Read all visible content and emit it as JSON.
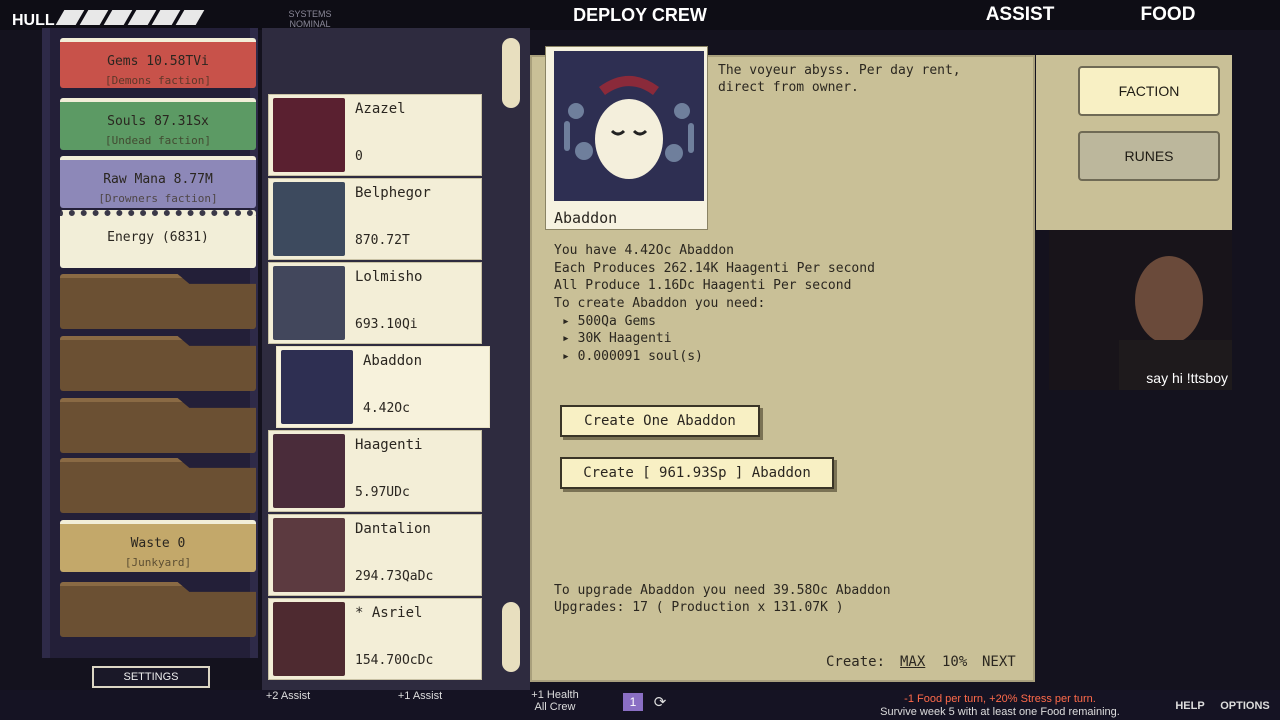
{
  "topbar": {
    "hull": "HULL",
    "systems": "SYSTEMS\nNOMINAL",
    "title": "DEPLOY CREW",
    "assist": "ASSIST",
    "food": "FOOD"
  },
  "factions": [
    {
      "label": "Gems 10.58TVi",
      "sub": "[Demons faction]",
      "color": "#c8524a"
    },
    {
      "label": "Souls 87.31Sx",
      "sub": "[Undead faction]",
      "color": "#5c9a64"
    },
    {
      "label": "Raw Mana 8.77M",
      "sub": "[Drowners faction]",
      "color": "#8d88b8"
    },
    {
      "label": "Energy (6831)",
      "sub": "",
      "color": "#f2eed8"
    },
    {
      "label": "Waste 0",
      "sub": "[Junkyard]",
      "color": "#c3a86a"
    }
  ],
  "settings_label": "SETTINGS",
  "monsters": [
    {
      "name": "Azazel",
      "value": "0",
      "bg": "#5a2030"
    },
    {
      "name": "Belphegor",
      "value": "870.72T",
      "bg": "#3d4a5e"
    },
    {
      "name": "Lolmisho",
      "value": "693.10Qi",
      "bg": "#42475c"
    },
    {
      "name": "Abaddon",
      "value": "4.42Oc",
      "bg": "#2e2f52"
    },
    {
      "name": "Haagenti",
      "value": "5.97UDc",
      "bg": "#4a2c3a"
    },
    {
      "name": "Dantalion",
      "value": "294.73QaDc",
      "bg": "#5c3a40"
    },
    {
      "name": "* Asriel",
      "value": "154.70OcDc",
      "bg": "#4e2a30"
    }
  ],
  "detail": {
    "portrait_name": "Abaddon",
    "description": "The voyeur abyss. Per day rent,\ndirect from owner.",
    "have": "You have 4.42Oc Abaddon",
    "each": "Each Produces 262.14K Haagenti Per second",
    "all": "All Produce 1.16Dc Haagenti Per second",
    "need_title": "To create Abaddon you need:",
    "needs": [
      "500Qa Gems",
      "30K Haagenti",
      "0.000091 soul(s)"
    ],
    "create_one": "Create One Abaddon",
    "create_max": "Create [ 961.93Sp ] Abaddon",
    "upgrade_need": "To upgrade Abaddon you need 39.58Oc Abaddon",
    "upgrades": "Upgrades: 17  ( Production x 131.07K )",
    "create_label": "Create:",
    "create_opts": [
      "MAX",
      "10%",
      "NEXT"
    ]
  },
  "right": {
    "faction": "FACTION",
    "runes": "RUNES"
  },
  "webcam_caption": "say hi !ttsboy",
  "bottom": {
    "assist1": "+2 Assist",
    "assist2": "+1 Assist",
    "health": "+1 Health\nAll Crew",
    "badge": "1",
    "status1": "-1 Food per turn, +20% Stress per turn.",
    "status2": "Survive week 5 with at least one Food remaining.",
    "help": "HELP",
    "options": "OPTIONS"
  }
}
